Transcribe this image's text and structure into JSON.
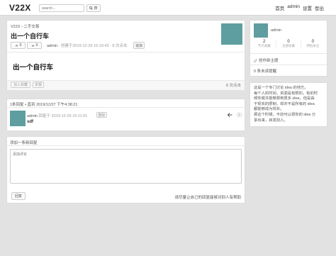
{
  "header": {
    "logo": "V22X",
    "search_placeholder": "search...",
    "search_button": "搜",
    "nav": [
      "首页",
      "admin",
      "设置",
      "登出"
    ]
  },
  "topic": {
    "breadcrumb_root": "V22X",
    "breadcrumb_sep": "›",
    "breadcrumb_node": "二手交易",
    "title": "出一个自行车",
    "upvotes": "0",
    "downvotes": "0",
    "author": "admin",
    "meta": "· 创建于2019-12-26 15:10:43 · 8 次点击",
    "append_button": "追加",
    "body": "出一个自行车",
    "favorite_button": "加入收藏",
    "report_button": "举报",
    "views": "8 次点击"
  },
  "replies": {
    "summary": "1条回复 • 直到 2019/12/27 下午4:38:21",
    "items": [
      {
        "author": "admin",
        "meta": "回复于 2019-12-26 15:11:01",
        "tag": "删除",
        "content": "sdf",
        "reply_icon": "reply-arrow-icon",
        "floor": "1"
      }
    ]
  },
  "new_reply": {
    "heading": "添加一条新回复",
    "placeholder": "添加评论",
    "submit": "回复",
    "hint": "请尽量让自己的回复能够对别人有帮助"
  },
  "sidebar": {
    "username": "admin",
    "stats": [
      {
        "value": "2",
        "label": "节点收藏"
      },
      {
        "value": "0",
        "label": "主题收藏"
      },
      {
        "value": "0",
        "label": "特别关注"
      }
    ],
    "create_topic": "创作新主题",
    "create_icon": "pencil-icon",
    "notifications": "0 条未读提醒",
    "about_lines": [
      "这是一个专门讨论 idea 的地方。",
      "每个人的时间，资源是有限的，有的时",
      "候你或许能够想到很多 idea，但是由",
      "于现实的限制，却并不是所有的 idea",
      "都能够成为现实。",
      "那这个时候，不妨可以把你的 idea 分",
      "享出来，启发别人。"
    ]
  }
}
